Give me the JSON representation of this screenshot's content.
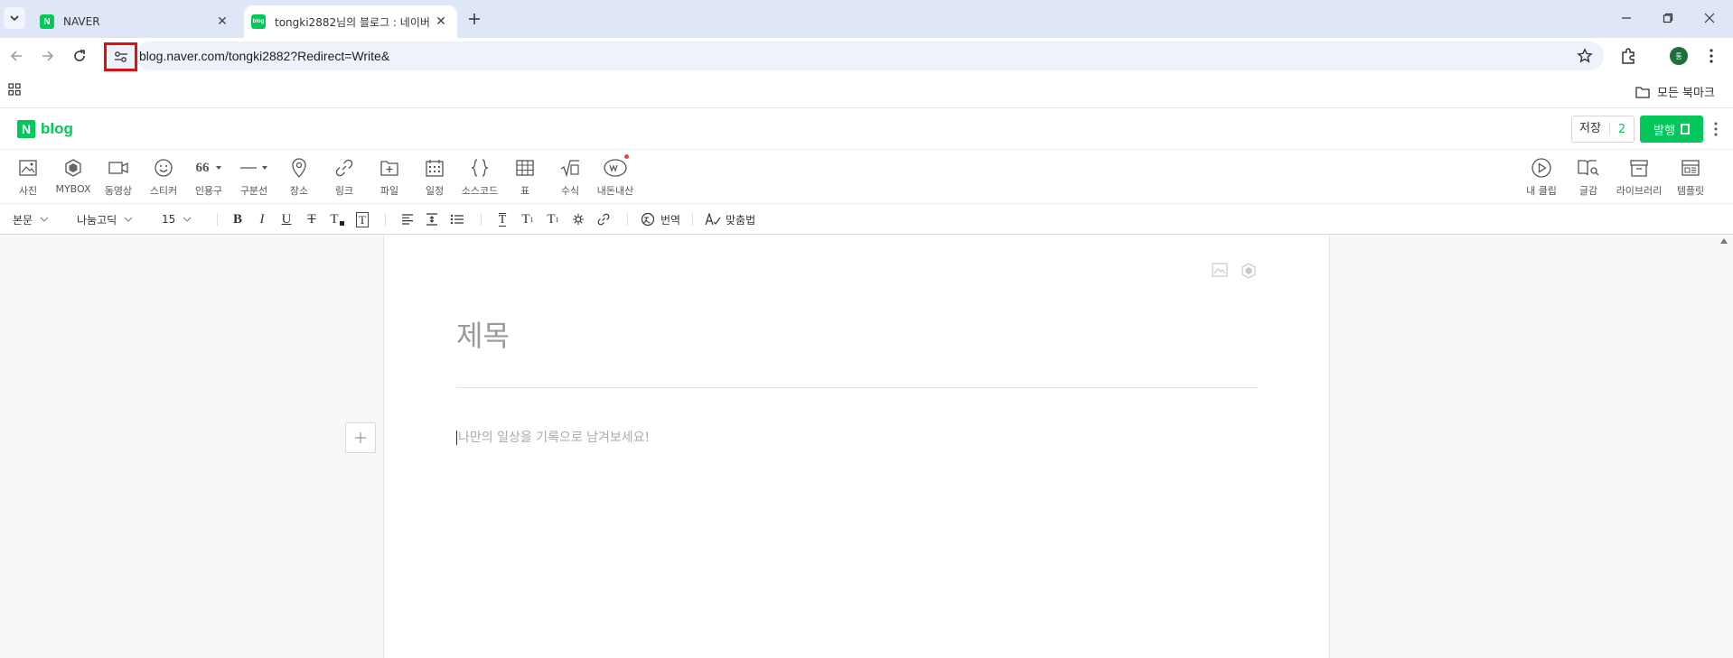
{
  "browser": {
    "tabs": [
      {
        "title": "NAVER",
        "favicon": "N",
        "active": false
      },
      {
        "title": "tongki2882님의 블로그 : 네이버",
        "favicon": "blog",
        "active": true
      }
    ],
    "url": "blog.naver.com/tongki2882?Redirect=Write&",
    "profile_initial": "통",
    "bookmarks_folder": "모든 북마크"
  },
  "editor_header": {
    "logo_n": "N",
    "logo_text": "blog",
    "save_label": "저장",
    "save_count": "2",
    "publish_label": "발행"
  },
  "insert_toolbar": {
    "left": [
      {
        "label": "사진",
        "icon": "photo-icon"
      },
      {
        "label": "MYBOX",
        "icon": "mybox-icon"
      },
      {
        "label": "동영상",
        "icon": "video-icon"
      },
      {
        "label": "스티커",
        "icon": "sticker-icon"
      },
      {
        "label": "인용구",
        "icon": "quote-icon"
      },
      {
        "label": "구분선",
        "icon": "divider-icon"
      },
      {
        "label": "장소",
        "icon": "place-icon"
      },
      {
        "label": "링크",
        "icon": "link-icon"
      },
      {
        "label": "파일",
        "icon": "file-icon"
      },
      {
        "label": "일정",
        "icon": "calendar-icon"
      },
      {
        "label": "소스코드",
        "icon": "source-code-icon"
      },
      {
        "label": "표",
        "icon": "table-icon"
      },
      {
        "label": "수식",
        "icon": "formula-icon"
      },
      {
        "label": "내돈내산",
        "icon": "my-money-icon"
      }
    ],
    "right": [
      {
        "label": "내 클립",
        "icon": "clip-icon"
      },
      {
        "label": "글감",
        "icon": "material-icon"
      },
      {
        "label": "라이브러리",
        "icon": "library-icon"
      },
      {
        "label": "템플릿",
        "icon": "template-icon"
      }
    ],
    "quote_glyph": "66"
  },
  "format_toolbar": {
    "paragraph_style": "본문",
    "font": "나눔고딕",
    "font_size": "15",
    "translate_label": "번역",
    "spellcheck_label": "맞춤법"
  },
  "document": {
    "title_placeholder": "제목",
    "body_placeholder": "나만의 일상을 기록으로 남겨보세요!"
  },
  "colors": {
    "naver_green": "#03c75a",
    "highlight_red": "#e01010"
  }
}
